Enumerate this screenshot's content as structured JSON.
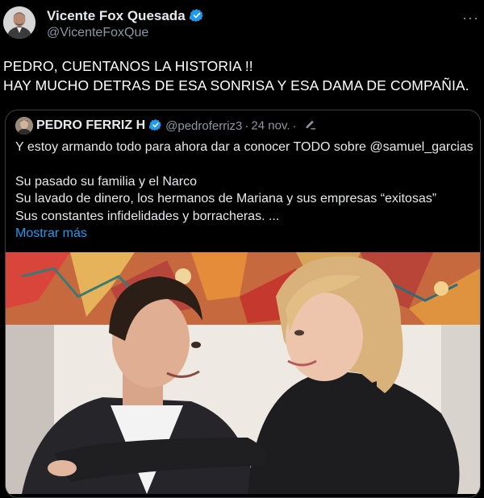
{
  "author": {
    "name": "Vicente Fox Quesada",
    "handle": "@VicenteFoxQue"
  },
  "tweet": {
    "lines": [
      "PEDRO, CUENTANOS LA HISTORIA !!",
      "HAY MUCHO DETRAS DE ESA SONRISA Y ESA DAMA DE COMPAÑIA."
    ]
  },
  "quote": {
    "name": "PEDRO FERRIZ H",
    "handle": "@pedroferriz3",
    "separator": "·",
    "date": "24 nov.",
    "lines": [
      "Y estoy armando todo para ahora dar a conocer TODO sobre @samuel_garcias",
      "",
      "Su pasado su familia y  el Narco",
      "Su lavado de dinero, los hermanos de Mariana y sus empresas “exitosas”",
      "Sus constantes infidelidades y borracheras. ..."
    ],
    "show_more": "Mostrar más"
  },
  "icons": {
    "verified": "verified-badge-icon",
    "more": "more-options-icon",
    "edited": "edited-pencil-icon"
  },
  "colors": {
    "background": "#000000",
    "text": "#e7e9ea",
    "secondary": "#8b98a5",
    "link": "#1d9bf0",
    "verified": "#1d9bf0",
    "border": "#3a3f44"
  }
}
